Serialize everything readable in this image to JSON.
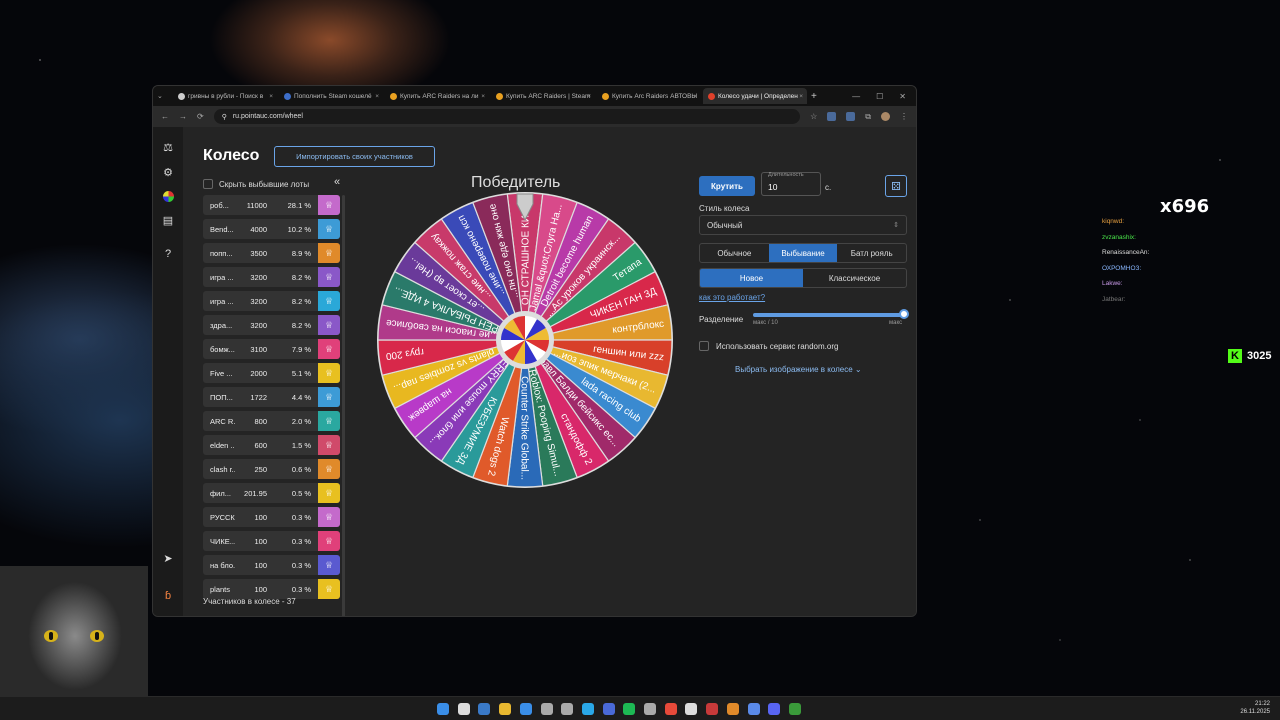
{
  "browser": {
    "tabs": [
      {
        "label": "гривны в рубли - Поиск в",
        "color": "#cccccc"
      },
      {
        "label": "Пополнить Steam кошелё",
        "color": "#3d6ec9"
      },
      {
        "label": "Купить ARC Raiders на ли",
        "color": "#e8a020"
      },
      {
        "label": "Купить ARC Raiders | Steam",
        "color": "#e8a020"
      },
      {
        "label": "Купить Arc Raiders АВТОВЫ",
        "color": "#e8a020"
      },
      {
        "label": "Колесо удачи | Определен",
        "color": "#e0402a",
        "active": true
      }
    ],
    "url": "ru.pointauc.com/wheel"
  },
  "page": {
    "title": "Колесо",
    "import_label": "Импортировать своих участников",
    "hide_lots_label": "Скрыть выбывшие лоты",
    "collapse_icon": "«",
    "participants_count": "Участников в колесе - 37",
    "winner_label": "Победитель"
  },
  "lots": [
    {
      "name": "роб...",
      "amount": "11000",
      "percent": "28.1 %",
      "color": "#c46acb"
    },
    {
      "name": "Bend...",
      "amount": "4000",
      "percent": "10.2 %",
      "color": "#3d9bd6"
    },
    {
      "name": "попп...",
      "amount": "3500",
      "percent": "8.9 %",
      "color": "#e08a2a"
    },
    {
      "name": "игра ...",
      "amount": "3200",
      "percent": "8.2 %",
      "color": "#8a58c8"
    },
    {
      "name": "игра ...",
      "amount": "3200",
      "percent": "8.2 %",
      "color": "#2aa8d8"
    },
    {
      "name": "здра...",
      "amount": "3200",
      "percent": "8.2 %",
      "color": "#8a58c8"
    },
    {
      "name": "бомж...",
      "amount": "3100",
      "percent": "7.9 %",
      "color": "#e0407a"
    },
    {
      "name": "Five ...",
      "amount": "2000",
      "percent": "5.1 %",
      "color": "#e8c020"
    },
    {
      "name": "ПОП...",
      "amount": "1722",
      "percent": "4.4 %",
      "color": "#3d9bd6"
    },
    {
      "name": "ARC R...",
      "amount": "800",
      "percent": "2.0 %",
      "color": "#2aa8a0"
    },
    {
      "name": "elden ...",
      "amount": "600",
      "percent": "1.5 %",
      "color": "#d04a6a"
    },
    {
      "name": "clash r...",
      "amount": "250",
      "percent": "0.6 %",
      "color": "#e08a2a"
    },
    {
      "name": "фил...",
      "amount": "201.95",
      "percent": "0.5 %",
      "color": "#e8c020"
    },
    {
      "name": "РУССК...",
      "amount": "100",
      "percent": "0.3 %",
      "color": "#c46acb"
    },
    {
      "name": "ЧИКЕ...",
      "amount": "100",
      "percent": "0.3 %",
      "color": "#e0407a"
    },
    {
      "name": "на бло...",
      "amount": "100",
      "percent": "0.3 %",
      "color": "#5a5ad0"
    },
    {
      "name": "plants",
      "amount": "100",
      "percent": "0.3 %",
      "color": "#e8c020"
    }
  ],
  "wheel": {
    "segments": [
      {
        "label": "ОН СТРАШНОЕ КИНО",
        "color": "#c8386a"
      },
      {
        "label": "Jamal &quot;Слуга На...",
        "color": "#d84a8a"
      },
      {
        "label": "Detroit become human",
        "color": "#b83aa8"
      },
      {
        "label": "...Ас уроков украинск...",
        "color": "#c8386a"
      },
      {
        "label": "Тетапа",
        "color": "#2a9a6a"
      },
      {
        "label": "ЧИКЕН ГАН 3Д",
        "color": "#d8284a"
      },
      {
        "label": "контрблокс",
        "color": "#e09a2a"
      },
      {
        "label": "геншин или zzz",
        "color": "#d8402a"
      },
      {
        "label": "...иоз эпик мерчаки (2...",
        "color": "#e8b830"
      },
      {
        "label": "lada racing club",
        "color": "#3a8ad0"
      },
      {
        "label": "Бравл Балди бейсикс ес...",
        "color": "#a02a6a"
      },
      {
        "label": "стандофф 2",
        "color": "#d8286a"
      },
      {
        "label": "Roblox: Pooping Simul...",
        "color": "#2a7a5a"
      },
      {
        "label": "Counter Strike Global...",
        "color": "#2a6ab8"
      },
      {
        "label": "Watch dogs 2",
        "color": "#e05a2a"
      },
      {
        "label": "КУБЕЗУМИЕ 3Д",
        "color": "#2a9a9a"
      },
      {
        "label": "JERRY mouse или блок...",
        "color": "#8a3ab8"
      },
      {
        "label": "на шарвеж",
        "color": "#b83ac8"
      },
      {
        "label": "plants vs zombies пар...",
        "color": "#e8b820"
      },
      {
        "label": "груз 200",
        "color": "#d8284a"
      },
      {
        "label": "...ие гиаоси на своблисе",
        "color": "#b03a8a"
      },
      {
        "label": "...ОРЕН РЫБАЛКА 4 ИДЕ...",
        "color": "#2a7a6a"
      },
      {
        "label": "...ет скоет вр (Hel...",
        "color": "#6a3a9a"
      },
      {
        "label": "...ние стаж пожкау",
        "color": "#c83a6a"
      },
      {
        "label": "...ине поверено ксп",
        "color": "#3a4ab8"
      },
      {
        "label": "...пн оно еде жкн оне",
        "color": "#8a2a5a"
      }
    ]
  },
  "controls": {
    "spin_label": "Крутить",
    "duration_label": "Длительность",
    "duration_value": "10",
    "duration_unit": "с.",
    "style_label": "Стиль колеса",
    "style_value": "Обычный",
    "modes": [
      "Обычное",
      "Выбывание",
      "Батл рояль"
    ],
    "active_mode": "Выбывание",
    "submodes": [
      "Новое",
      "Классическое"
    ],
    "active_submode": "Новое",
    "how_link": "как это работает?",
    "split_label": "Разделение",
    "split_min": "макс / 10",
    "split_max": "макс",
    "random_org_label": "Использовать сервис random.org",
    "image_select_label": "Выбрать изображение в колесе"
  },
  "overlay": {
    "chat": [
      {
        "user": "kiqnwd:",
        "color": "#e8a040"
      },
      {
        "user": "zvzanashix:",
        "color": "#4ae84a"
      },
      {
        "user": "RenaissanceAn:",
        "color": "#dddddd"
      },
      {
        "user": "ОХРОМНОЗ:",
        "color": "#8ab8ff"
      },
      {
        "user": "Lakwe:",
        "color": "#c89ae8"
      },
      {
        "user": "Jatbear:",
        "color": "#777777"
      },
      {
        "user": "",
        "color": "#555555"
      }
    ],
    "counter": "x696",
    "kick_count": "3025"
  },
  "taskbar": {
    "time": "21:22",
    "date": "26.11.2025"
  }
}
